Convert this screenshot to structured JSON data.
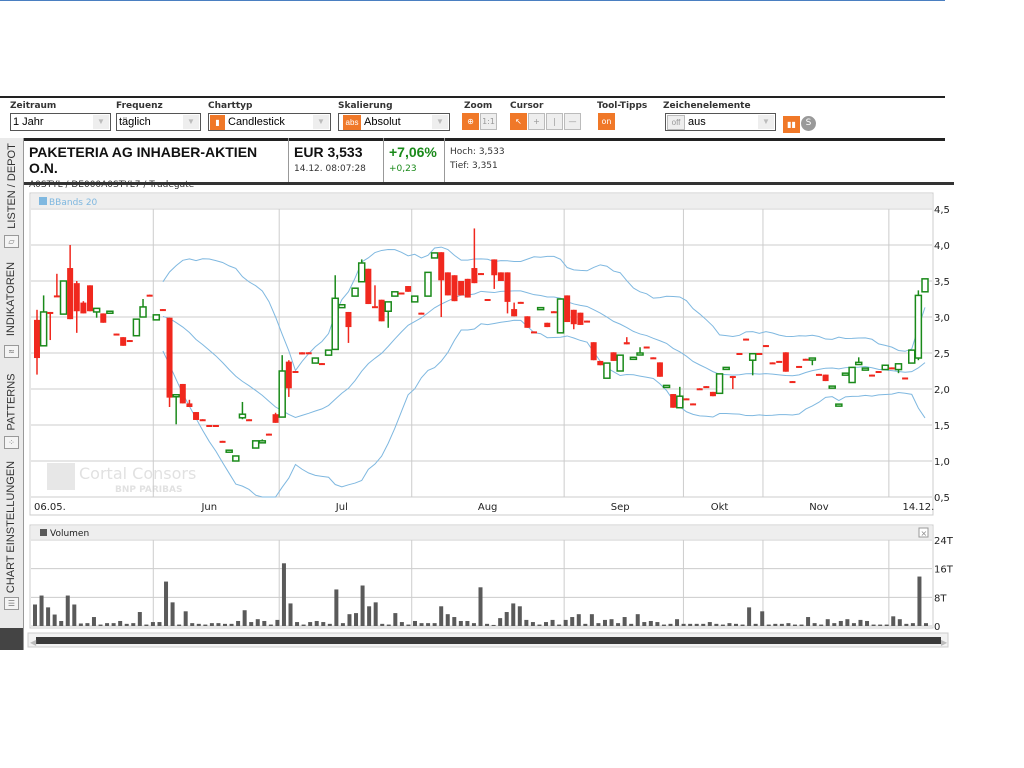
{
  "toolbar": {
    "zeitraum": {
      "label": "Zeitraum",
      "value": "1 Jahr"
    },
    "frequenz": {
      "label": "Frequenz",
      "value": "täglich"
    },
    "charttyp": {
      "label": "Charttyp",
      "value": "Candlestick"
    },
    "skalierung": {
      "label": "Skalierung",
      "value": "Absolut",
      "badge": "abs"
    },
    "zoom": {
      "label": "Zoom",
      "reset": "1:1"
    },
    "cursor": {
      "label": "Cursor"
    },
    "tooltips": {
      "label": "Tool-Tipps",
      "value": "on"
    },
    "zeichen": {
      "label": "Zeichenelemente",
      "badge": "off",
      "value": "aus"
    }
  },
  "sidetabs": [
    "LISTEN / DEPOT",
    "INDIKATOREN",
    "PATTERNS",
    "CHART EINSTELLUNGEN"
  ],
  "header": {
    "name": "PAKETERIA AG INHABER-AKTIEN O.N.",
    "ids": "A0STYL / DE000A0STYL7 / Tradegate",
    "price": "EUR 3,533",
    "time": "14.12. 08:07:28",
    "change_pct": "+7,06%",
    "change_abs": "+0,23",
    "high": "Hoch: 3,533",
    "low": "Tief: 3,351"
  },
  "colors": {
    "up": "#1a8a1a",
    "down": "#f0281e",
    "band": "#7fb8e0",
    "volume": "#5a5a5a",
    "accent": "#f07828"
  },
  "watermark": {
    "line1": "Cortal Consors",
    "line2": "BNP PARIBAS"
  },
  "chart_data": [
    {
      "type": "candlestick",
      "legend": "BBands 20",
      "y_ticks": [
        "4,5",
        "4,0",
        "3,5",
        "3,0",
        "2,5",
        "2,0",
        "1,5",
        "1,0",
        "0,5"
      ],
      "ylim": [
        0.5,
        4.5
      ],
      "x_labels": [
        "06.05.",
        "Jun",
        "Jul",
        "Aug",
        "Sep",
        "Okt",
        "Nov",
        "14.12."
      ],
      "grid": true,
      "ohlc": [
        [
          2.96,
          3.1,
          2.2,
          2.43
        ],
        [
          2.6,
          3.3,
          2.6,
          3.07
        ],
        [
          3.07,
          3.07,
          2.68,
          3.05
        ],
        [
          3.3,
          3.6,
          3.28,
          3.28
        ],
        [
          3.04,
          3.5,
          3.04,
          3.5
        ],
        [
          3.68,
          4.0,
          2.97,
          2.97
        ],
        [
          3.47,
          3.5,
          2.78,
          3.08
        ],
        [
          3.2,
          3.22,
          3.05,
          3.05
        ],
        [
          3.44,
          3.44,
          3.08,
          3.08
        ],
        [
          3.07,
          3.12,
          2.99,
          3.12
        ],
        [
          3.05,
          3.05,
          2.92,
          2.92
        ],
        [
          3.06,
          3.08,
          3.06,
          3.08
        ],
        [
          2.77,
          2.77,
          2.75,
          2.75
        ],
        [
          2.72,
          2.72,
          2.6,
          2.6
        ],
        [
          2.68,
          2.68,
          2.66,
          2.66
        ],
        [
          2.74,
          2.97,
          2.74,
          2.97
        ],
        [
          3.0,
          3.25,
          3.0,
          3.14
        ],
        [
          3.31,
          3.31,
          3.29,
          3.29
        ],
        [
          2.96,
          3.03,
          2.96,
          3.03
        ],
        [
          3.11,
          3.11,
          3.09,
          3.09
        ],
        [
          2.99,
          2.99,
          1.75,
          1.88
        ],
        [
          1.9,
          1.92,
          1.51,
          1.92
        ],
        [
          2.07,
          2.07,
          1.8,
          1.8
        ],
        [
          1.8,
          1.85,
          1.75,
          1.75
        ],
        [
          1.68,
          1.68,
          1.57,
          1.57
        ],
        [
          1.58,
          1.58,
          1.56,
          1.56
        ],
        [
          1.5,
          1.5,
          1.49,
          1.49
        ],
        [
          1.5,
          1.5,
          1.48,
          1.48
        ],
        [
          1.28,
          1.28,
          1.26,
          1.26
        ],
        [
          1.13,
          1.15,
          1.13,
          1.15
        ],
        [
          1.0,
          1.07,
          1.0,
          1.07
        ],
        [
          1.6,
          1.82,
          1.58,
          1.65
        ],
        [
          1.58,
          1.58,
          1.56,
          1.56
        ],
        [
          1.18,
          1.28,
          1.18,
          1.28
        ],
        [
          1.26,
          1.3,
          1.26,
          1.28
        ],
        [
          1.38,
          1.38,
          1.36,
          1.36
        ],
        [
          1.65,
          1.67,
          1.53,
          1.53
        ],
        [
          1.61,
          2.47,
          1.61,
          2.25
        ],
        [
          2.38,
          2.4,
          1.89,
          2.01
        ],
        [
          2.25,
          2.25,
          2.23,
          2.23
        ],
        [
          2.51,
          2.51,
          2.48,
          2.48
        ],
        [
          2.51,
          2.51,
          2.49,
          2.49
        ],
        [
          2.36,
          2.43,
          2.36,
          2.43
        ],
        [
          2.36,
          2.36,
          2.34,
          2.34
        ],
        [
          2.47,
          2.54,
          2.47,
          2.54
        ],
        [
          2.55,
          3.58,
          2.55,
          3.26
        ],
        [
          3.13,
          3.17,
          3.13,
          3.17
        ],
        [
          3.07,
          3.07,
          2.64,
          2.86
        ],
        [
          3.29,
          3.4,
          3.29,
          3.4
        ],
        [
          3.49,
          3.8,
          3.49,
          3.75
        ],
        [
          3.67,
          3.67,
          3.18,
          3.18
        ],
        [
          3.15,
          3.44,
          3.13,
          3.13
        ],
        [
          3.24,
          3.24,
          2.94,
          2.94
        ],
        [
          3.08,
          3.21,
          2.85,
          3.21
        ],
        [
          3.29,
          3.35,
          3.29,
          3.35
        ],
        [
          3.34,
          3.34,
          3.32,
          3.32
        ],
        [
          3.43,
          3.43,
          3.35,
          3.35
        ],
        [
          3.21,
          3.29,
          3.21,
          3.29
        ],
        [
          3.06,
          3.06,
          3.04,
          3.04
        ],
        [
          3.29,
          3.62,
          3.29,
          3.62
        ],
        [
          3.82,
          3.89,
          3.82,
          3.89
        ],
        [
          3.9,
          3.9,
          3.0,
          3.51
        ],
        [
          3.62,
          3.62,
          3.3,
          3.3
        ],
        [
          3.58,
          3.58,
          3.22,
          3.22
        ],
        [
          3.5,
          3.5,
          3.3,
          3.3
        ],
        [
          3.53,
          3.53,
          3.27,
          3.27
        ],
        [
          3.68,
          4.23,
          3.47,
          3.47
        ],
        [
          3.61,
          3.61,
          3.59,
          3.59
        ],
        [
          3.25,
          3.25,
          3.23,
          3.23
        ],
        [
          3.8,
          3.8,
          3.39,
          3.58
        ],
        [
          3.62,
          3.62,
          3.5,
          3.5
        ],
        [
          3.62,
          3.62,
          3.05,
          3.21
        ],
        [
          3.11,
          3.2,
          3.01,
          3.01
        ],
        [
          3.21,
          3.21,
          3.19,
          3.19
        ],
        [
          3.01,
          3.01,
          2.85,
          2.85
        ],
        [
          2.8,
          2.8,
          2.78,
          2.78
        ],
        [
          3.11,
          3.13,
          3.11,
          3.13
        ],
        [
          2.92,
          2.92,
          2.86,
          2.86
        ],
        [
          3.08,
          3.08,
          3.06,
          3.06
        ],
        [
          2.78,
          3.25,
          2.78,
          3.25
        ],
        [
          3.3,
          3.3,
          2.93,
          2.93
        ],
        [
          3.1,
          3.1,
          2.83,
          2.9
        ],
        [
          3.06,
          3.06,
          2.89,
          2.89
        ],
        [
          2.95,
          2.95,
          2.93,
          2.93
        ],
        [
          2.65,
          2.65,
          2.4,
          2.4
        ],
        [
          2.39,
          2.39,
          2.33,
          2.33
        ],
        [
          2.15,
          2.36,
          2.15,
          2.36
        ],
        [
          2.51,
          2.51,
          2.39,
          2.39
        ],
        [
          2.25,
          2.47,
          2.25,
          2.47
        ],
        [
          2.65,
          2.72,
          2.62,
          2.62
        ],
        [
          2.42,
          2.44,
          2.42,
          2.44
        ],
        [
          2.48,
          2.58,
          2.48,
          2.5
        ],
        [
          2.59,
          2.59,
          2.57,
          2.57
        ],
        [
          2.44,
          2.44,
          2.42,
          2.42
        ],
        [
          2.37,
          2.37,
          2.17,
          2.17
        ],
        [
          2.03,
          2.05,
          2.03,
          2.05
        ],
        [
          1.93,
          1.93,
          1.74,
          1.74
        ],
        [
          1.74,
          2.03,
          1.74,
          1.9
        ],
        [
          1.87,
          1.87,
          1.85,
          1.85
        ],
        [
          1.8,
          1.8,
          1.78,
          1.78
        ],
        [
          2.01,
          2.01,
          1.99,
          1.99
        ],
        [
          2.04,
          2.04,
          2.02,
          2.02
        ],
        [
          1.96,
          1.96,
          1.9,
          1.9
        ],
        [
          1.94,
          2.21,
          1.94,
          2.21
        ],
        [
          2.28,
          2.3,
          2.28,
          2.3
        ],
        [
          2.18,
          2.18,
          2.0,
          2.16
        ],
        [
          2.5,
          2.5,
          2.48,
          2.48
        ],
        [
          2.7,
          2.7,
          2.68,
          2.68
        ],
        [
          2.4,
          2.49,
          2.19,
          2.49
        ],
        [
          2.5,
          2.5,
          2.48,
          2.48
        ],
        [
          2.61,
          2.61,
          2.59,
          2.59
        ],
        [
          2.37,
          2.37,
          2.35,
          2.35
        ],
        [
          2.39,
          2.39,
          2.37,
          2.37
        ],
        [
          2.51,
          2.51,
          2.24,
          2.24
        ],
        [
          2.11,
          2.11,
          2.09,
          2.09
        ],
        [
          2.32,
          2.32,
          2.3,
          2.3
        ],
        [
          2.42,
          2.42,
          2.4,
          2.4
        ],
        [
          2.41,
          2.43,
          2.33,
          2.43
        ],
        [
          2.21,
          2.21,
          2.19,
          2.19
        ],
        [
          2.2,
          2.2,
          2.11,
          2.11
        ],
        [
          2.02,
          2.04,
          2.02,
          2.04
        ],
        [
          1.77,
          1.79,
          1.77,
          1.79
        ],
        [
          2.2,
          2.22,
          2.2,
          2.22
        ],
        [
          2.09,
          2.3,
          2.09,
          2.3
        ],
        [
          2.34,
          2.44,
          2.34,
          2.37
        ],
        [
          2.27,
          2.29,
          2.27,
          2.29
        ],
        [
          2.2,
          2.2,
          2.18,
          2.18
        ],
        [
          2.25,
          2.25,
          2.23,
          2.23
        ],
        [
          2.27,
          2.33,
          2.27,
          2.33
        ],
        [
          2.3,
          2.3,
          2.28,
          2.28
        ],
        [
          2.27,
          2.35,
          2.22,
          2.35
        ],
        [
          2.16,
          2.16,
          2.14,
          2.14
        ],
        [
          2.36,
          2.54,
          2.36,
          2.54
        ],
        [
          2.43,
          3.37,
          2.4,
          3.3
        ],
        [
          3.35,
          3.53,
          3.35,
          3.53
        ]
      ]
    },
    {
      "type": "bar",
      "legend": "Volumen",
      "y_ticks": [
        "24T",
        "16T",
        "8T",
        "0"
      ],
      "ylim": [
        0,
        24
      ],
      "unit": "T",
      "values": [
        6,
        8.5,
        5.2,
        3.2,
        1.4,
        8.5,
        6,
        0.7,
        0.8,
        2.5,
        0.4,
        0.8,
        0.8,
        1.4,
        0.6,
        0.8,
        3.9,
        0.4,
        1.1,
        1.1,
        12.4,
        6.6,
        0.4,
        4.1,
        0.8,
        0.6,
        0.4,
        0.8,
        0.8,
        0.6,
        0.6,
        1.4,
        4.4,
        1.1,
        1.9,
        1.4,
        0.4,
        1.7,
        17.5,
        6.3,
        1.1,
        0.4,
        1.1,
        1.4,
        1.1,
        0.6,
        10.2,
        0.8,
        3.3,
        3.6,
        11.3,
        5.5,
        6.6,
        0.6,
        0.4,
        3.6,
        1.1,
        0.4,
        1.4,
        0.8,
        0.8,
        0.8,
        5.5,
        3.3,
        2.5,
        1.4,
        1.4,
        0.8,
        10.8,
        0.6,
        0.3,
        2.2,
        3.9,
        6.3,
        5.5,
        1.7,
        1.1,
        0.4,
        1.1,
        1.7,
        0.4,
        1.7,
        2.5,
        3.3,
        0.6,
        3.3,
        0.8,
        1.7,
        1.9,
        0.8,
        2.5,
        0.6,
        3.3,
        1.1,
        1.4,
        1.1,
        0.4,
        0.6,
        1.9,
        0.6,
        0.6,
        0.6,
        0.6,
        1.1,
        0.6,
        0.4,
        0.8,
        0.6,
        0.4,
        5.2,
        0.6,
        4.1,
        0.4,
        0.6,
        0.6,
        0.8,
        0.4,
        0.4,
        2.5,
        0.8,
        0.4,
        1.9,
        0.8,
        1.4,
        1.9,
        0.8,
        1.7,
        1.4,
        0.4,
        0.4,
        0.4,
        2.7,
        1.9,
        0.6,
        0.8,
        13.8,
        0.8
      ]
    }
  ]
}
